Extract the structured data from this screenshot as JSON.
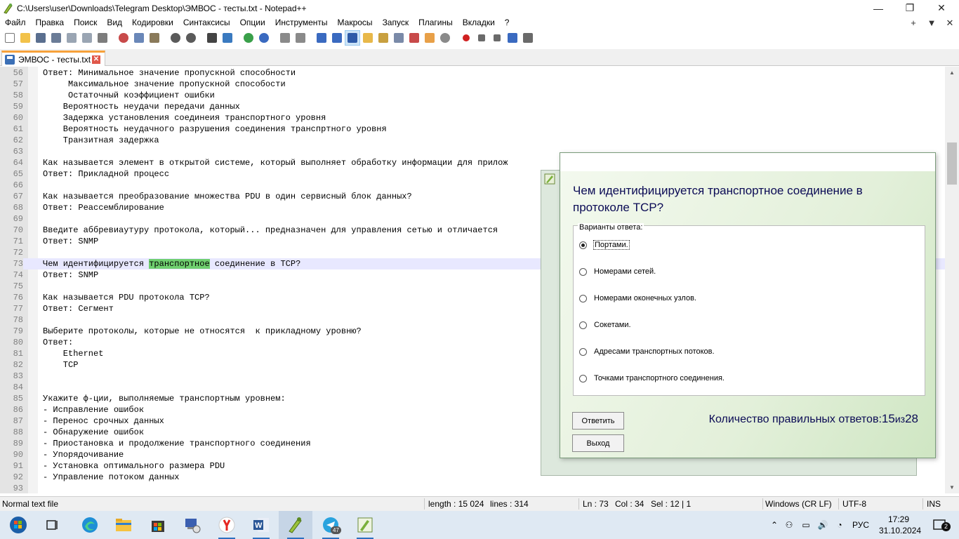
{
  "window": {
    "title": "C:\\Users\\user\\Downloads\\Telegram Desktop\\ЭМВОС - тесты.txt - Notepad++",
    "minimize": "—",
    "restore": "❐",
    "close": "✕"
  },
  "menu": {
    "items": [
      "Файл",
      "Правка",
      "Поиск",
      "Вид",
      "Кодировки",
      "Синтаксисы",
      "Опции",
      "Инструменты",
      "Макросы",
      "Запуск",
      "Плагины",
      "Вкладки",
      "?"
    ],
    "right_plus": "+",
    "right_dropdown": "▼",
    "right_close": "✕"
  },
  "tab": {
    "label": "ЭМВОС - тесты.txt",
    "close": "✕"
  },
  "editor": {
    "current_line": "73",
    "highlight_word": "транспортное",
    "lines": [
      {
        "n": "56",
        "t": "Ответ: Минимальное значение пропускной способности"
      },
      {
        "n": "57",
        "t": "     Максимальное значение пропускной способости"
      },
      {
        "n": "58",
        "t": "     Остаточный коэффициент ошибки"
      },
      {
        "n": "59",
        "t": "    Вероятность неудачи передачи данных"
      },
      {
        "n": "60",
        "t": "    Задержка установления соединеия транспортного уровня"
      },
      {
        "n": "61",
        "t": "    Вероятность неудачного разрушения соединения транспртного уровня"
      },
      {
        "n": "62",
        "t": "    Транзитная задержка"
      },
      {
        "n": "63",
        "t": ""
      },
      {
        "n": "64",
        "t": "Как называется элемент в открытой системе, который выполняет обработку информации для прилож"
      },
      {
        "n": "65",
        "t": "Ответ: Прикладной процесс"
      },
      {
        "n": "66",
        "t": ""
      },
      {
        "n": "67",
        "t": "Как называется преобразование множества PDU в один сервисный блок данных?"
      },
      {
        "n": "68",
        "t": "Ответ: Реассемблирование"
      },
      {
        "n": "69",
        "t": ""
      },
      {
        "n": "70",
        "t": "Введите аббревиаутуру протокола, который... предназначен для управления сетью и отличается"
      },
      {
        "n": "71",
        "t": "Ответ: SNMP"
      },
      {
        "n": "72",
        "t": ""
      },
      {
        "n": "73",
        "t": "Чем идентифицируется транспортное соединение в TCP?"
      },
      {
        "n": "74",
        "t": "Ответ: SNMP"
      },
      {
        "n": "75",
        "t": ""
      },
      {
        "n": "76",
        "t": "Как называется PDU протокола TCP?"
      },
      {
        "n": "77",
        "t": "Ответ: Сегмент"
      },
      {
        "n": "78",
        "t": ""
      },
      {
        "n": "79",
        "t": "Выберите протоколы, которые не относятся  к прикладному уровню?"
      },
      {
        "n": "80",
        "t": "Ответ:"
      },
      {
        "n": "81",
        "t": "    Ethernet"
      },
      {
        "n": "82",
        "t": "    TCP"
      },
      {
        "n": "83",
        "t": ""
      },
      {
        "n": "84",
        "t": ""
      },
      {
        "n": "85",
        "t": "Укажите ф-ции, выполняемые транспортным уровнем:"
      },
      {
        "n": "86",
        "t": "- Исправление ошибок"
      },
      {
        "n": "87",
        "t": "- Перенос срочных данных"
      },
      {
        "n": "88",
        "t": "- Обнаружение ошибок"
      },
      {
        "n": "89",
        "t": "- Приостановка и продолжение транспортного соединения"
      },
      {
        "n": "90",
        "t": "- Упорядочивание"
      },
      {
        "n": "91",
        "t": "- Установка оптимального размера PDU"
      },
      {
        "n": "92",
        "t": "- Управление потоком данных"
      },
      {
        "n": "93",
        "t": ""
      }
    ]
  },
  "status": {
    "file_type": "Normal text file",
    "length": "length : 15 024",
    "lines": "lines : 314",
    "ln": "Ln : 73",
    "col": "Col : 34",
    "sel": "Sel : 12 | 1",
    "eol": "Windows (CR LF)",
    "encoding": "UTF-8",
    "mode": "INS"
  },
  "quiz": {
    "question": "Чем идентифицируется транспортное соединение в протоколе TCP?",
    "group_label": "Варианты ответа:",
    "options": [
      {
        "label": "Портами.",
        "selected": true
      },
      {
        "label": "Номерами сетей.",
        "selected": false
      },
      {
        "label": "Номерами оконечных узлов.",
        "selected": false
      },
      {
        "label": "Сокетами.",
        "selected": false
      },
      {
        "label": "Адресами транспортных потоков.",
        "selected": false
      },
      {
        "label": "Точками транспортного соединения.",
        "selected": false
      }
    ],
    "answer_button": "Ответить",
    "exit_button": "Выход",
    "score_label": "Количество правильных ответов:",
    "score_correct": "15",
    "score_of": "из",
    "score_total": "28"
  },
  "taskbar": {
    "lang": "РУС",
    "time": "17:29",
    "date": "31.10.2024",
    "notifications": "2",
    "telegram_badge": "47",
    "apps": [
      "start-icon",
      "task-view-icon",
      "edge-icon",
      "file-explorer-icon",
      "store-icon",
      "network-tool-icon",
      "yandex-browser-icon",
      "word-icon",
      "notepadpp-icon",
      "telegram-icon",
      "test-app-icon"
    ]
  },
  "colors": {
    "tab_accent": "#f7a13a",
    "current_line_bg": "#e8e8ff",
    "search_highlight": "#6fcf6f",
    "question_text": "#0b0b55"
  }
}
